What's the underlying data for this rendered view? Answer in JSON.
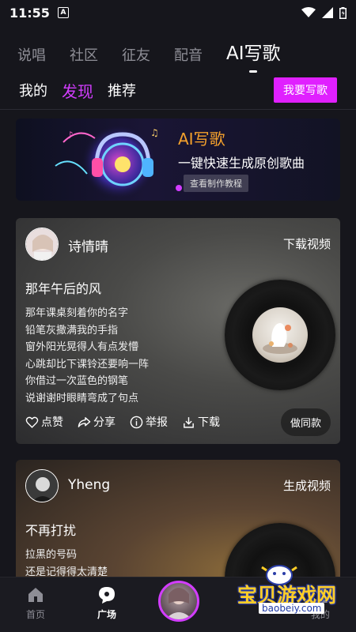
{
  "status_bar": {
    "time": "11:55",
    "notif_icon_letter": "A"
  },
  "top_tabs": [
    {
      "label": "说唱",
      "active": false
    },
    {
      "label": "社区",
      "active": false
    },
    {
      "label": "征友",
      "active": false
    },
    {
      "label": "配音",
      "active": false
    },
    {
      "label": "AI写歌",
      "active": true
    }
  ],
  "sub_tabs": [
    {
      "label": "我的",
      "active": false
    },
    {
      "label": "发现",
      "active": true
    },
    {
      "label": "推荐",
      "active": false
    }
  ],
  "write_button": "我要写歌",
  "banner": {
    "title": "AI写歌",
    "subtitle": "一键快速生成原创歌曲",
    "tutorial_button": "查看制作教程"
  },
  "cards": [
    {
      "user_name": "诗情晴",
      "action": "下载视频",
      "song_title": "那年午后的风",
      "lyrics": [
        "那年课桌刻着你的名字",
        "铅笔灰撒满我的手指",
        "窗外阳光晃得人有点发懵",
        "心跳却比下课铃还要响一阵",
        "你借过一次蓝色的钢笔",
        "说谢谢时眼睛弯成了句点"
      ],
      "actions": {
        "like": "点赞",
        "share": "分享",
        "report": "举报",
        "download": "下载"
      },
      "same_button": "做同款"
    },
    {
      "user_name": "Yheng",
      "action": "生成视频",
      "song_title": "不再打扰",
      "lyrics": [
        "拉黑的号码",
        "还是记得得太清楚"
      ]
    }
  ],
  "bottom_nav": [
    {
      "label": "首页",
      "icon": "home-icon",
      "active": false
    },
    {
      "label": "广场",
      "icon": "chat-bubble-icon",
      "active": true
    },
    {
      "label": "我的",
      "icon": "profile-icon",
      "active": false
    }
  ],
  "watermark": {
    "text_cn": "宝贝游戏网",
    "url": "baobeiy.com"
  },
  "colors": {
    "accent": "#d23dff",
    "button": "#e020ff",
    "banner_title": "#f5a12c",
    "background": "#16161c"
  }
}
